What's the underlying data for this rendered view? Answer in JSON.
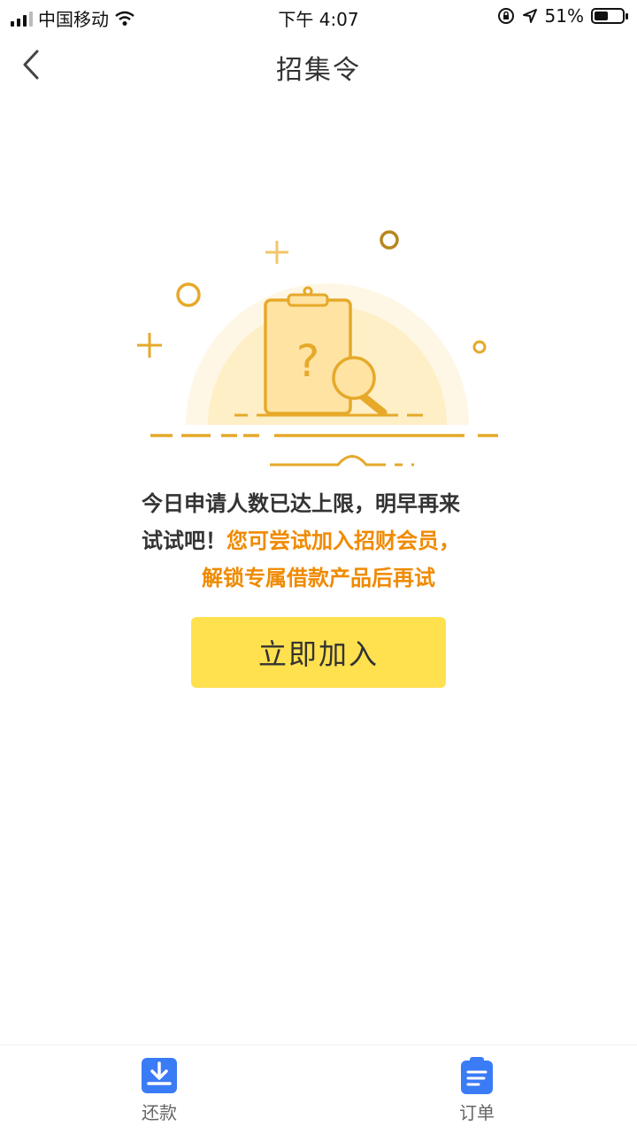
{
  "status_bar": {
    "carrier": "中国移动",
    "time": "下午 4:07",
    "battery_percent": "51%",
    "battery_level": 0.51
  },
  "nav": {
    "title": "招集令",
    "back_icon": "chevron-left-icon"
  },
  "message": {
    "line1": "今日申请人数已达上限，明早再来",
    "line2_normal": "试试吧！",
    "line2_highlight": "您可尝试加入招财会员，",
    "line3_highlight": "解锁专属借款产品后再试"
  },
  "join_button": {
    "label": "立即加入"
  },
  "tab_bar": {
    "items": [
      {
        "label": "还款",
        "icon": "download-icon"
      },
      {
        "label": "订单",
        "icon": "document-list-icon"
      }
    ]
  },
  "colors": {
    "accent_yellow": "#FFE14F",
    "highlight_orange": "#F08A00",
    "tab_blue": "#3A7BF6",
    "illustration_gold": "#E6A92A"
  }
}
